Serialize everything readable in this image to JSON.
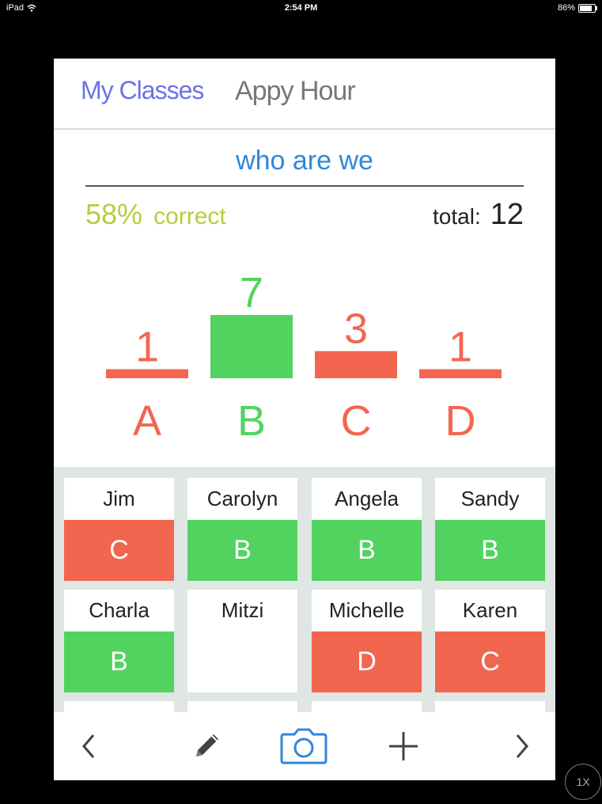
{
  "status": {
    "device": "iPad",
    "time": "2:54 PM",
    "battery": "86%",
    "battery_level": 0.86
  },
  "nav": {
    "back_label": "My Classes",
    "title": "Appy Hour"
  },
  "question": {
    "title": "who are we",
    "percent": "58%",
    "percent_label": "correct",
    "total_label": "total:",
    "total": "12"
  },
  "colors": {
    "correct": "#52d35f",
    "wrong": "#f26650",
    "title": "#2f87dc",
    "percent": "#b9cc3c",
    "grid_bg": "#dfe6e3"
  },
  "chart_data": {
    "type": "bar",
    "categories": [
      "A",
      "B",
      "C",
      "D"
    ],
    "values": [
      1,
      7,
      3,
      1
    ],
    "correct": "B"
  },
  "students": [
    {
      "name": "Jim",
      "answer": "C"
    },
    {
      "name": "Carolyn",
      "answer": "B"
    },
    {
      "name": "Angela",
      "answer": "B"
    },
    {
      "name": "Sandy",
      "answer": "B"
    },
    {
      "name": "Charla",
      "answer": "B"
    },
    {
      "name": "Mitzi",
      "answer": ""
    },
    {
      "name": "Michelle",
      "answer": "D"
    },
    {
      "name": "Karen",
      "answer": "C"
    }
  ],
  "toolbar": {
    "items": [
      "chevron-left-icon",
      "pencil-icon",
      "camera-icon",
      "plus-icon",
      "chevron-right-icon"
    ]
  },
  "zoom_label": "1X"
}
